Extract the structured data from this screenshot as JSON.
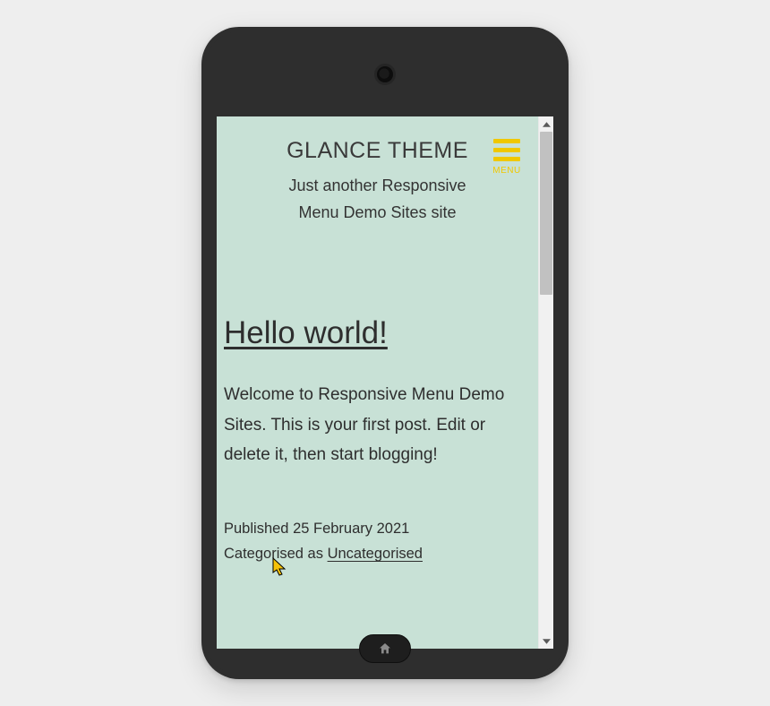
{
  "header": {
    "site_title": "GLANCE THEME",
    "tagline": "Just another Responsive Menu Demo Sites site",
    "menu_label": "MENU"
  },
  "post": {
    "title": "Hello world!",
    "body": "Welcome to Responsive Menu Demo Sites. This is your first post. Edit or delete it, then start blogging!",
    "published_prefix": "Published ",
    "published_date": "25 February 2021",
    "categorised_prefix": "Categorised as ",
    "category": "Uncategorised"
  },
  "colors": {
    "page_bg": "#c8e1d6",
    "accent": "#f0c800"
  }
}
